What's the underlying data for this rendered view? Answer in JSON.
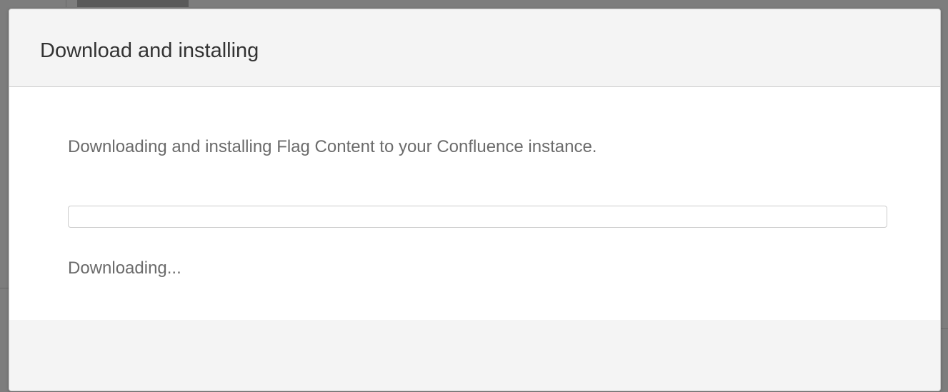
{
  "dialog": {
    "title": "Download and installing",
    "message": "Downloading and installing Flag Content to your Confluence instance.",
    "progress": {
      "fraction": 0
    },
    "status": "Downloading..."
  },
  "colors": {
    "overlay": "#7d7d7d",
    "header_bg": "#f4f4f4",
    "text_primary": "#333333",
    "text_secondary": "#6b6b6b",
    "progress_border": "#cccccc"
  }
}
